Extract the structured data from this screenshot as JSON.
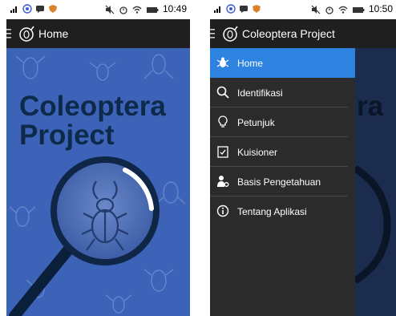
{
  "left_screen": {
    "status": {
      "time": "10:49"
    },
    "appbar": {
      "title": "Home"
    },
    "splash": {
      "title_line1": "Coleoptera",
      "title_line2": "Project"
    }
  },
  "right_screen": {
    "status": {
      "time": "10:50"
    },
    "appbar": {
      "title": "Coleoptera Project"
    },
    "background_text": "ra",
    "drawer": {
      "items": [
        {
          "label": "Home",
          "icon": "beetle-icon",
          "active": true
        },
        {
          "label": "Identifikasi",
          "icon": "search-icon",
          "active": false
        },
        {
          "label": "Petunjuk",
          "icon": "lightbulb-icon",
          "active": false
        },
        {
          "label": "Kuisioner",
          "icon": "clipboard-check-icon",
          "active": false
        },
        {
          "label": "Basis Pengetahuan",
          "icon": "person-gear-icon",
          "active": false
        },
        {
          "label": "Tentang Aplikasi",
          "icon": "info-icon",
          "active": false
        }
      ]
    }
  },
  "colors": {
    "drawer_bg": "#2b2b2b",
    "active_item": "#2e83e0",
    "appbar": "#1f1f1f",
    "splash_bg": "#3d63b9",
    "title_text": "#0e2a4a"
  }
}
